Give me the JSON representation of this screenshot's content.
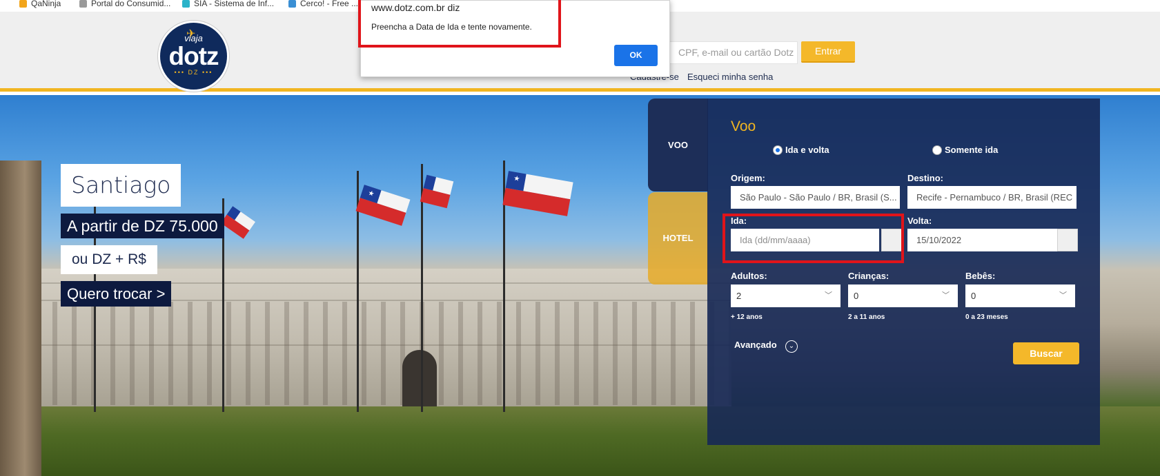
{
  "bookmarks": [
    {
      "label": "QaNinja",
      "color": "#f2a51b"
    },
    {
      "label": "Portal do Consumid...",
      "color": "#9a9a9a"
    },
    {
      "label": "SIA - Sistema de Inf...",
      "color": "#2bb3c9"
    },
    {
      "label": "Cerco! - Free ...",
      "color": "#3a8fd4"
    }
  ],
  "header": {
    "logo": {
      "top_text": "viaja",
      "brand": "dotz",
      "badge": "••• DZ •••"
    },
    "login_placeholder": "CPF, e-mail ou cartão Dotz",
    "login_button": "Entrar",
    "signup_link": "Cadastre-se",
    "forgot_link": "Esqueci minha senha"
  },
  "promo": {
    "destination": "Santiago",
    "price": "A partir de DZ 75.000",
    "alt_price": "ou DZ + R$",
    "cta": "Quero trocar >"
  },
  "booking": {
    "tabs": {
      "flight": "VOO",
      "hotel": "HOTEL"
    },
    "title": "Voo",
    "trip_types": [
      {
        "label": "Ida e volta",
        "selected": true
      },
      {
        "label": "Somente ida",
        "selected": false
      }
    ],
    "origin": {
      "label": "Origem:",
      "value": "São Paulo - São Paulo / BR, Brasil (S..."
    },
    "destination": {
      "label": "Destino:",
      "value": "Recife - Pernambuco / BR, Brasil (REC"
    },
    "departure": {
      "label": "Ida:",
      "placeholder": "Ida (dd/mm/aaaa)",
      "value": ""
    },
    "return": {
      "label": "Volta:",
      "value": "15/10/2022"
    },
    "adults": {
      "label": "Adultos:",
      "value": "2",
      "hint": "+ 12 anos"
    },
    "children": {
      "label": "Crianças:",
      "value": "0",
      "hint": "2 a 11 anos"
    },
    "infants": {
      "label": "Bebês:",
      "value": "0",
      "hint": "0 a 23 meses"
    },
    "advanced": "Avançado",
    "search_button": "Buscar"
  },
  "dialog": {
    "origin": "www.dotz.com.br diz",
    "message": "Preencha a Data de Ida e tente novamente.",
    "ok": "OK"
  },
  "colors": {
    "accent": "#f4b82a",
    "navy": "#1d2e58",
    "highlight": "#e0141a",
    "dialog_button": "#1a73e8"
  }
}
